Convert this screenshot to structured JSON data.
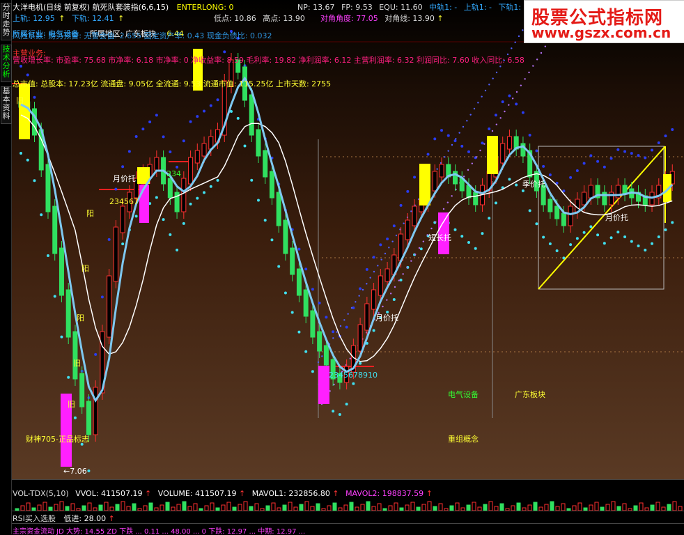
{
  "sidebar": {
    "tabs": [
      "分时走势",
      "技术分析",
      "基本资料"
    ]
  },
  "header": {
    "line1": {
      "title": "大洋电机(日线 前复权) 航死队套装指(6,6,15)",
      "enterlong": "ENTERLONG: 0",
      "np": "NP: 13.67",
      "fp": "FP: 9.53",
      "equ": "EQU: 11.60",
      "mid": "中轨1: -",
      "upper": "上轨1: -",
      "lower": "下轨1: 16.8"
    },
    "line2": {
      "upper": "上轨: 12.95",
      "lower": "下轨: 12.41",
      "low": "低点: 10.86",
      "high": "高点: 13.90",
      "angle": "对角角度: 77.05",
      "diag": "对角线: 13.90"
    },
    "line3": {
      "industry": "所属行业: 电气设备",
      "region": "所属地区: 广东板块",
      "price": "6.44"
    },
    "line4": "风险系数: 财务预警: 无警会值: 2.655 固定资产率: 0.43 现金负债比: 0.032",
    "line5": "主营业务:",
    "line6": "营收增长率: 市盈率: 75.68 市净率: 6.18 市净率: 0 净收益率: 8.59 毛利率: 19.82 净利润率: 6.12 主营利润率: 6.32 利润同比: 7.60 收入同比: 6.58",
    "line7": "总市值: 总股本: 17.23亿 流通盘: 9.05亿 全流通: 9.53 流通市值: 115.25亿 上市天数: 2755"
  },
  "watermark": {
    "title": "股票公式指标网",
    "url": "www.gszx.com.cn"
  },
  "chart": {
    "labels": {
      "yue_jia_tuo_1": "月价托",
      "yue_jia_tuo_2": "月价托",
      "yue_jia_tuo_3": "月价托",
      "ji_jia_tuo": "季价托",
      "duan_chang_tuo": "短长托",
      "seq1": "234567",
      "seq2": "2345678910",
      "seq3": "234",
      "yang1": "阳",
      "yang2": "阳",
      "yang3": "阳",
      "jiu1": "旧",
      "jiu2": "旧",
      "jiu3": "旧",
      "elec": "电气设备",
      "gd": "广东板块",
      "reorg": "重组概念",
      "caishen": "财神705-正品标志",
      "low_mark": "←7.06"
    }
  },
  "vol_panel": {
    "name": "VOL-TDX(5,10)",
    "vvol": "VVOL: 411507.19",
    "volume": "VOLUME: 411507.19",
    "mavol1": "MAVOL1: 232856.80",
    "mavol2": "MAVOL2: 198837.59"
  },
  "rsi_panel": {
    "name": "RSI买入选股",
    "low": "低进: 28.00"
  },
  "bottom_panel": {
    "text": "主宗资金流动  JD 大势: 14.55  ZD 下跌 ... 0.11 ... 48.00 ... 0 下跌: 12.97  ...  中期: 12.97  ..."
  },
  "colors": {
    "bg_top": "#000000",
    "bg_bottom": "#5a3a24",
    "ma_white": "#ffffff",
    "ma_blue": "#7ec8f0",
    "dot_blue": "#2a3cf0",
    "dot_cyan": "#40e0f0",
    "dot_violet": "#b070f0",
    "up_candle": "#ff3030",
    "down_candle": "#30e060",
    "yellow": "#ffff00",
    "magenta": "#ff20ff"
  }
}
